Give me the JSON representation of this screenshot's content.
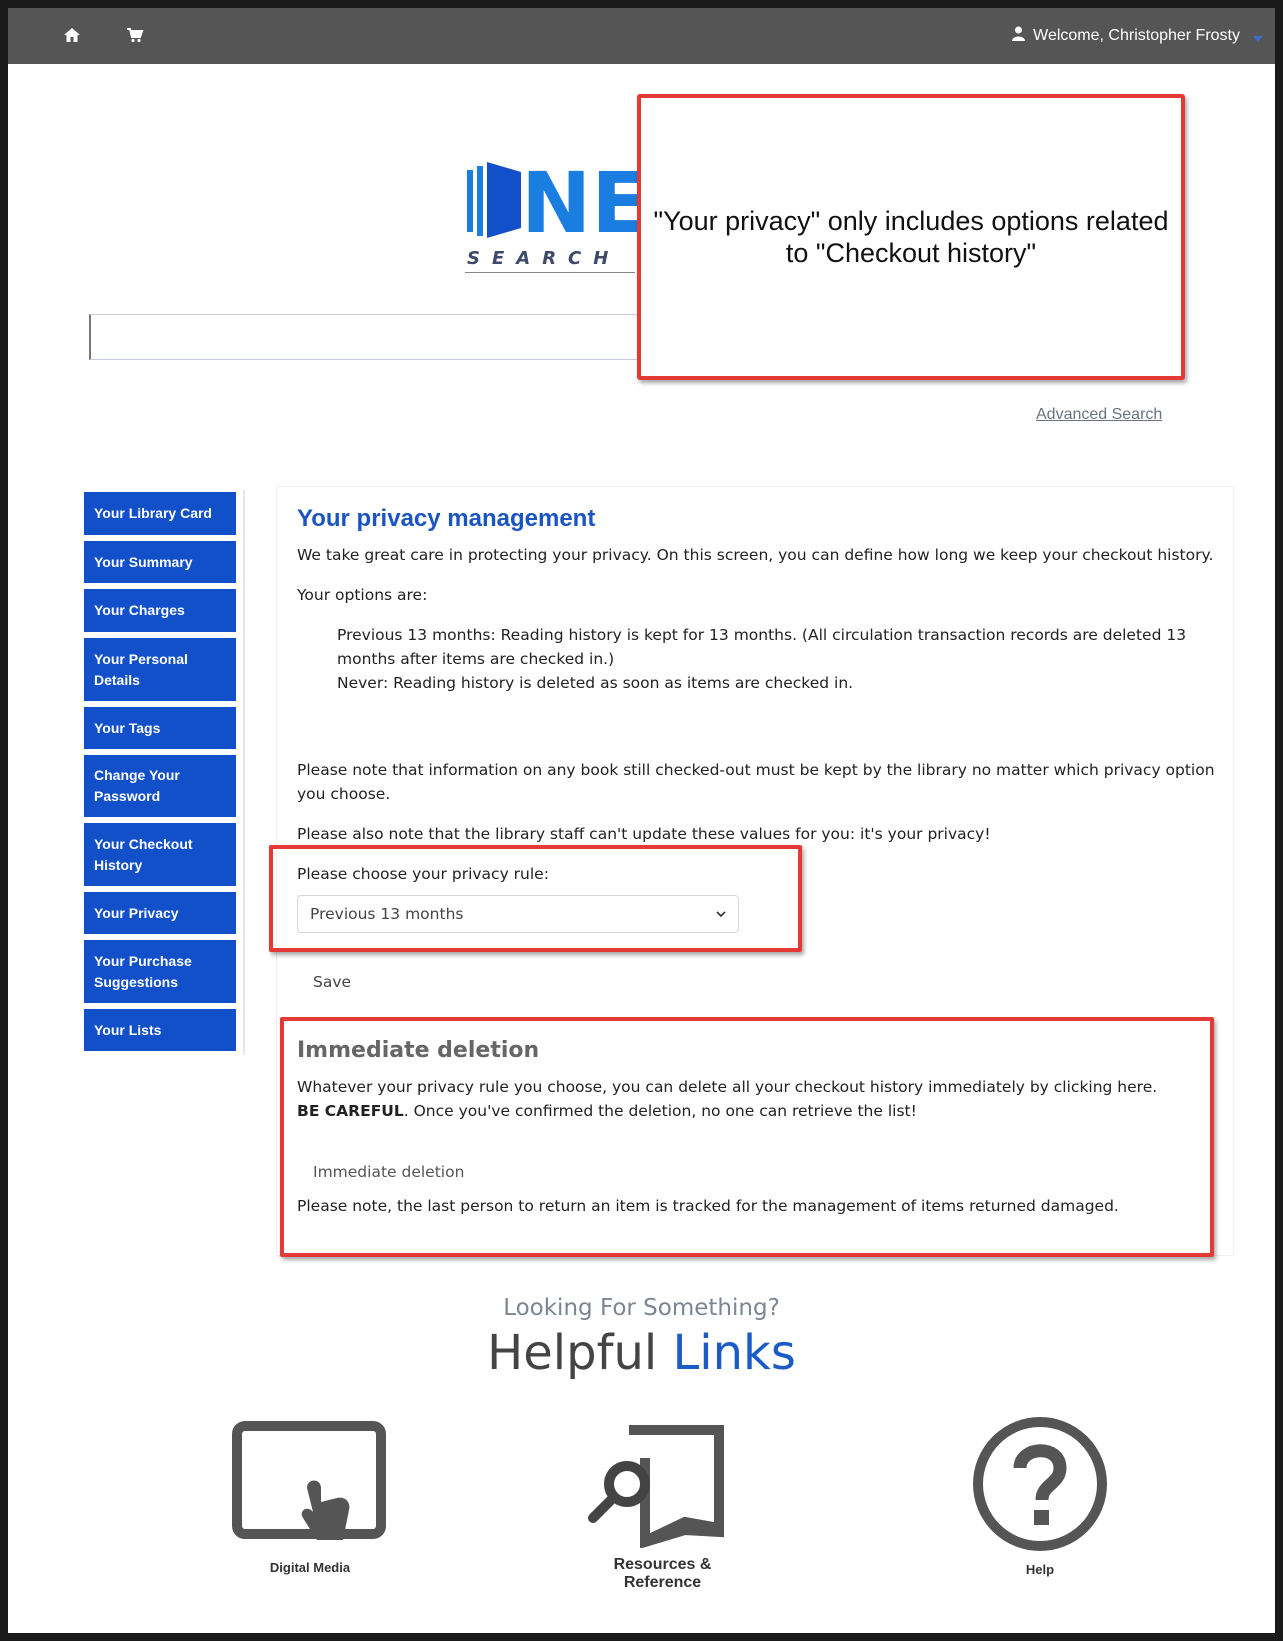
{
  "header": {
    "home_icon": "home-icon",
    "cart_icon": "cart-icon",
    "user_icon": "user-icon",
    "welcome_text": "Welcome, Christopher Frosty"
  },
  "logo": {
    "letters": "NE",
    "word": "SEARCH"
  },
  "search": {
    "value": "",
    "advanced_label": "Advanced Search"
  },
  "annotations": {
    "top_note": "\"Your privacy\" only includes options related to \"Checkout history\""
  },
  "sidebar": {
    "items": [
      {
        "label": "Your Library Card"
      },
      {
        "label": "Your Summary"
      },
      {
        "label": "Your Charges"
      },
      {
        "label": "Your Personal Details"
      },
      {
        "label": "Your Tags"
      },
      {
        "label": "Change Your Password"
      },
      {
        "label": "Your Checkout History"
      },
      {
        "label": "Your Privacy"
      },
      {
        "label": "Your Purchase Suggestions"
      },
      {
        "label": "Your Lists"
      }
    ]
  },
  "main": {
    "title": "Your privacy management",
    "intro": "We take great care in protecting your privacy. On this screen, you can define how long we keep your checkout history.",
    "options_heading": "Your options are:",
    "option_1": "Previous 13 months: Reading history is kept for 13 months. (All circulation transaction records are deleted 13 months after items are checked in.)",
    "option_2": "Never: Reading history is deleted as soon as items are checked in.",
    "note_1": "Please note that information on any book still checked-out must be kept by the library no matter which privacy option you choose.",
    "note_2": "Please also note that the library staff can't update these values for you: it's your privacy!",
    "choose_label": "Please choose your privacy rule:",
    "select_value": "Previous 13 months",
    "save_label": "Save"
  },
  "deletion": {
    "title": "Immediate deletion",
    "text_before": "Whatever your privacy rule you choose, you can delete all your checkout history immediately by clicking here. ",
    "text_bold": "BE CAREFUL",
    "text_after": ". Once you've confirmed the deletion, no one can retrieve the list!",
    "button_label": "Immediate deletion",
    "footnote": "Please note, the last person to return an item is tracked for the management of items returned damaged."
  },
  "helpful_links": {
    "subtitle": "Looking For Something?",
    "title_part1": "Helpful ",
    "title_part2": "Links",
    "tiles": [
      {
        "label": "Digital Media",
        "icon": "tablet-touch-icon"
      },
      {
        "label": "Resources & Reference",
        "icon": "magnifier-book-icon"
      },
      {
        "label": "Help",
        "icon": "question-circle-icon"
      }
    ]
  },
  "colors": {
    "topbar": "#555555",
    "sidebar": "#1150c9",
    "title_blue": "#1a55c2",
    "annotation_red": "#e53935"
  }
}
